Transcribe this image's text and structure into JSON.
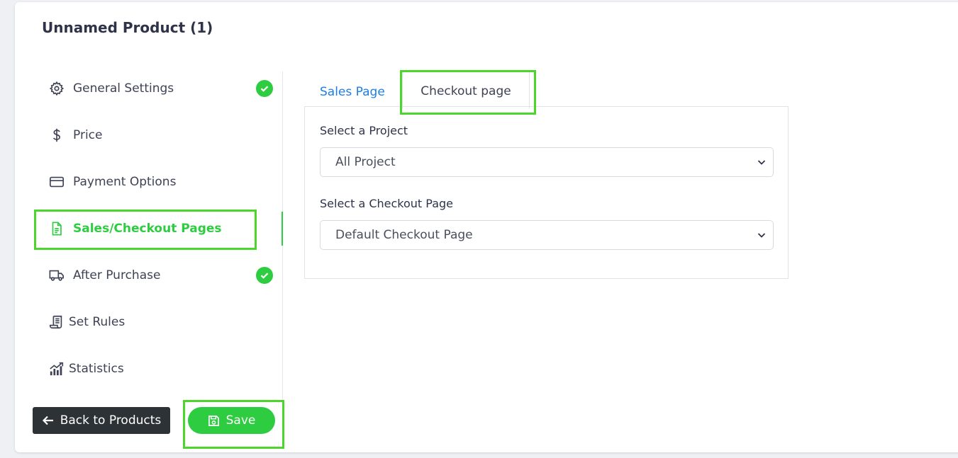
{
  "page_title": "Unnamed Product (1)",
  "sidebar": {
    "items": [
      {
        "label": "General Settings",
        "icon": "gear-icon",
        "completed": true
      },
      {
        "label": "Price",
        "icon": "dollar-icon",
        "completed": false
      },
      {
        "label": "Payment Options",
        "icon": "credit-card-icon",
        "completed": false
      },
      {
        "label": "Sales/Checkout Pages",
        "icon": "document-icon",
        "completed": false,
        "active": true
      },
      {
        "label": "After Purchase",
        "icon": "truck-icon",
        "completed": true
      },
      {
        "label": "Set Rules",
        "icon": "scroll-icon",
        "completed": false
      },
      {
        "label": "Statistics",
        "icon": "chart-icon",
        "completed": false
      }
    ]
  },
  "tabs": [
    {
      "label": "Sales Page",
      "active": false
    },
    {
      "label": "Checkout page",
      "active": true
    }
  ],
  "form": {
    "project_label": "Select a Project",
    "project_value": "All Project",
    "checkout_label": "Select a Checkout Page",
    "checkout_value": "Default Checkout Page"
  },
  "footer": {
    "back_label": "Back to Products",
    "save_label": "Save"
  },
  "colors": {
    "accent_green": "#2ecc40",
    "highlight_green": "#4cd62b",
    "link_blue": "#1e7ee6",
    "dark_button": "#2d3236"
  }
}
